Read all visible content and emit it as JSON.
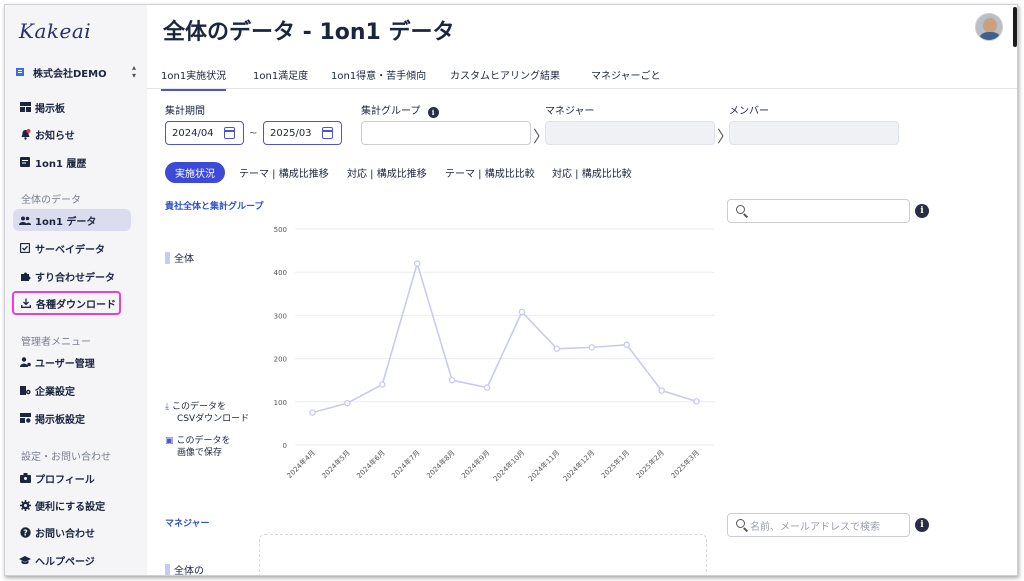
{
  "app": {
    "logo": "Kakeai",
    "company": "株式会社DEMO"
  },
  "sidebar": {
    "items": [
      {
        "label": "掲示板",
        "icon": "board-icon"
      },
      {
        "label": "お知らせ",
        "icon": "bell-icon"
      },
      {
        "label": "1on1 履歴",
        "icon": "history-icon"
      },
      {
        "label": "1on1 データ",
        "icon": "people-icon"
      },
      {
        "label": "サーベイデータ",
        "icon": "checkbox-icon"
      },
      {
        "label": "すり合わせデータ",
        "icon": "puzzle-icon"
      },
      {
        "label": "各種ダウンロード",
        "icon": "download-icon"
      },
      {
        "label": "ユーザー管理",
        "icon": "user-manage-icon"
      },
      {
        "label": "企業設定",
        "icon": "company-settings-icon"
      },
      {
        "label": "掲示板設定",
        "icon": "board-settings-icon"
      },
      {
        "label": "プロフィール",
        "icon": "profile-icon"
      },
      {
        "label": "便利にする設定",
        "icon": "gear-icon"
      },
      {
        "label": "お問い合わせ",
        "icon": "help-icon"
      },
      {
        "label": "ヘルプページ",
        "icon": "graduation-icon"
      }
    ],
    "sections": [
      "全体のデータ",
      "管理者メニュー",
      "設定・お問い合わせ"
    ]
  },
  "header": {
    "title": "全体のデータ - 1on1 データ"
  },
  "tabs": [
    "1on1実施状況",
    "1on1満足度",
    "1on1得意・苦手傾向",
    "カスタムヒアリング結果",
    "マネジャーごと"
  ],
  "filters": {
    "period_label": "集計期間",
    "start": "2024/04",
    "tilde": "~",
    "end": "2025/03",
    "group_label": "集計グループ",
    "manager_label": "マネジャー",
    "member_label": "メンバー"
  },
  "pills": [
    "実施状況",
    "テーマ | 構成比推移",
    "対応 | 構成比推移",
    "テーマ | 構成比比較",
    "対応 | 構成比比較"
  ],
  "chart_section": {
    "title": "貴社全体と集計グループ",
    "legend": "全体",
    "csv_link": [
      "このデータを",
      "CSVダウンロード"
    ],
    "img_link": [
      "このデータを",
      "画像で保存"
    ]
  },
  "chart_data": {
    "type": "line",
    "categories": [
      "2024年4月",
      "2024年5月",
      "2024年6月",
      "2024年7月",
      "2024年8月",
      "2024年9月",
      "2024年10月",
      "2024年11月",
      "2024年12月",
      "2025年1月",
      "2025年2月",
      "2025年3月"
    ],
    "series": [
      {
        "name": "全体",
        "values": [
          75,
          97,
          140,
          420,
          150,
          133,
          308,
          223,
          226,
          232,
          126,
          101
        ]
      }
    ],
    "yticks": [
      0,
      100,
      200,
      300,
      400,
      500
    ],
    "ylim": [
      0,
      500
    ],
    "color": "#c9caf3"
  },
  "manager_section": {
    "title": "マネジャー",
    "search_placeholder": "名前、メールアドレスで検索",
    "legend": "全体の"
  },
  "colors": {
    "accent": "#3d4ad8",
    "highlight": "#ea3fd1",
    "line": "#c9caf3"
  }
}
